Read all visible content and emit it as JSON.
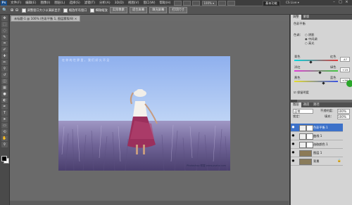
{
  "app": {
    "logo": "Ps",
    "workspace": "基本功能",
    "cs_live": "CS Live ▾"
  },
  "menu": [
    "文件(F)",
    "编辑(E)",
    "图像(I)",
    "图层(L)",
    "选择(S)",
    "滤镜(T)",
    "分析(A)",
    "3D(D)",
    "视图(V)",
    "窗口(W)",
    "帮助(H)"
  ],
  "menubar_zoom": "100% ▾",
  "window_controls": [
    "–",
    "□",
    "×"
  ],
  "options": {
    "buttons": [
      "实际像素",
      "适合屏幕",
      "填充屏幕",
      "打印尺寸"
    ],
    "checks": [
      "调整窗口大小以满屏显示",
      "缩放所有窗口",
      "细微缩放"
    ]
  },
  "document": {
    "tab_label": "未标题-1 @ 100% (色彩平衡 1, 图层蒙版/8) ×",
    "caption": "在 你 的 世 界 里 ， 我 们 好 久 不 见",
    "watermark": "Photoshop 联盟 www.psahz.com"
  },
  "adjustments": {
    "tabs": [
      "调整",
      "蒙版"
    ],
    "title": "色彩平衡",
    "tone_label": "色调：",
    "tones": [
      "阴影",
      "中间调",
      "高光"
    ],
    "selected_tone": "中间调",
    "sliders": [
      {
        "left": "青色",
        "right": "红色",
        "value": "-47",
        "level": 0.38
      },
      {
        "left": "洋红",
        "right": "绿色",
        "value": "+19",
        "level": 0.59
      },
      {
        "left": "黄色",
        "right": "蓝色",
        "value": "+36",
        "level": 0.68
      }
    ],
    "preserve": "保留明度"
  },
  "layers": {
    "tabs": [
      "图层",
      "通道",
      "路径"
    ],
    "blend_mode": "正常",
    "opacity_label": "不透明度：",
    "opacity": "100%",
    "lock_label": "锁定：",
    "fill_label": "填充：",
    "fill": "100%",
    "items": [
      "色彩平衡 1",
      "曲线 1",
      "选取颜色 1",
      "图层 1",
      "背景"
    ]
  },
  "colors": {
    "photo_sky": "#a9c3ef",
    "photo_field": "#7d6fa0",
    "selected_layer": "#3c71c9"
  }
}
